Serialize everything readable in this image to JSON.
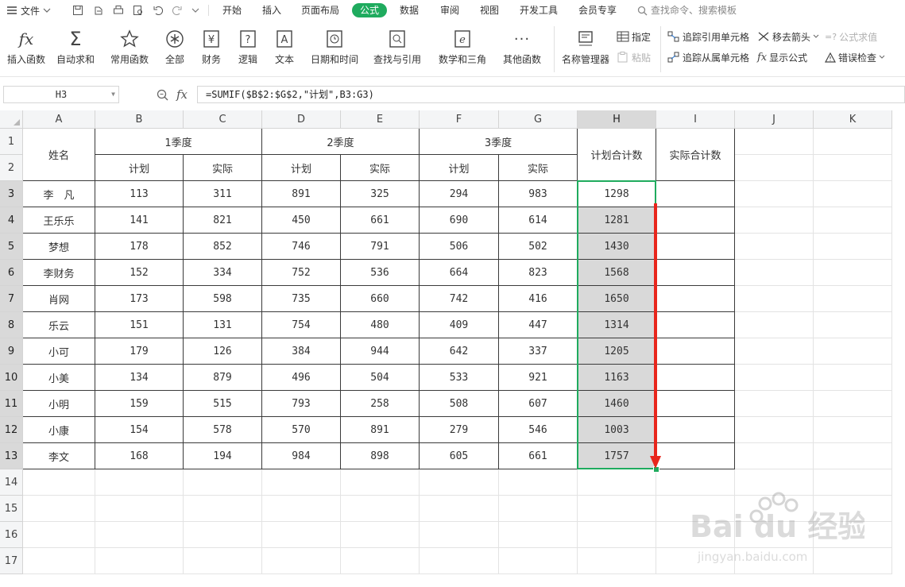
{
  "menubar": {
    "file_label": "文件",
    "tabs": [
      {
        "label": "开始",
        "active": false
      },
      {
        "label": "插入",
        "active": false
      },
      {
        "label": "页面布局",
        "active": false
      },
      {
        "label": "公式",
        "active": true
      },
      {
        "label": "数据",
        "active": false
      },
      {
        "label": "审阅",
        "active": false
      },
      {
        "label": "视图",
        "active": false
      },
      {
        "label": "开发工具",
        "active": false
      },
      {
        "label": "会员专享",
        "active": false
      }
    ],
    "search_placeholder": "查找命令、搜索模板"
  },
  "ribbon": {
    "buttons": [
      {
        "label": "插入函数",
        "icon": "function-icon"
      },
      {
        "label": "自动求和",
        "icon": "sigma-icon"
      },
      {
        "label": "常用函数",
        "icon": "star-icon"
      },
      {
        "label": "全部",
        "icon": "asterisk-icon"
      },
      {
        "label": "财务",
        "icon": "yen-icon"
      },
      {
        "label": "逻辑",
        "icon": "question-icon"
      },
      {
        "label": "文本",
        "icon": "text-a-icon"
      },
      {
        "label": "日期和时间",
        "icon": "clock-icon"
      },
      {
        "label": "查找与引用",
        "icon": "lookup-icon"
      },
      {
        "label": "数学和三角",
        "icon": "theta-icon"
      },
      {
        "label": "其他函数",
        "icon": "more-icon"
      },
      {
        "label": "名称管理器",
        "icon": "name-manager-icon"
      }
    ],
    "small": {
      "assign": "指定",
      "paste": "粘贴",
      "trace_precedents": "追踪引用单元格",
      "trace_dependents": "追踪从属单元格",
      "remove_arrows": "移去箭头",
      "show_formulas": "显示公式",
      "evaluate": "公式求值",
      "error_check": "错误检查"
    }
  },
  "formula_bar": {
    "cell_ref": "H3",
    "fx_label": "fx",
    "formula": "=SUMIF($B$2:$G$2,\"计划\",B3:G3)"
  },
  "columns": [
    "A",
    "B",
    "C",
    "D",
    "E",
    "F",
    "G",
    "H",
    "I",
    "J",
    "K"
  ],
  "rows": [
    "1",
    "2",
    "3",
    "4",
    "5",
    "6",
    "7",
    "8",
    "9",
    "10",
    "11",
    "12",
    "13",
    "14",
    "15",
    "16",
    "17"
  ],
  "table": {
    "name_header": "姓名",
    "quarters": [
      "1季度",
      "2季度",
      "3季度"
    ],
    "sub_plan": "计划",
    "sub_actual": "实际",
    "plan_total_header": "计划合计数",
    "actual_total_header": "实际合计数",
    "records": [
      {
        "name": "李　凡",
        "q1p": 113,
        "q1a": 311,
        "q2p": 891,
        "q2a": 325,
        "q3p": 294,
        "q3a": 983,
        "plan_total": 1298
      },
      {
        "name": "王乐乐",
        "q1p": 141,
        "q1a": 821,
        "q2p": 450,
        "q2a": 661,
        "q3p": 690,
        "q3a": 614,
        "plan_total": 1281
      },
      {
        "name": "梦想",
        "q1p": 178,
        "q1a": 852,
        "q2p": 746,
        "q2a": 791,
        "q3p": 506,
        "q3a": 502,
        "plan_total": 1430
      },
      {
        "name": "李财务",
        "q1p": 152,
        "q1a": 334,
        "q2p": 752,
        "q2a": 536,
        "q3p": 664,
        "q3a": 823,
        "plan_total": 1568
      },
      {
        "name": "肖网",
        "q1p": 173,
        "q1a": 598,
        "q2p": 735,
        "q2a": 660,
        "q3p": 742,
        "q3a": 416,
        "plan_total": 1650
      },
      {
        "name": "乐云",
        "q1p": 151,
        "q1a": 131,
        "q2p": 754,
        "q2a": 480,
        "q3p": 409,
        "q3a": 447,
        "plan_total": 1314
      },
      {
        "name": "小可",
        "q1p": 179,
        "q1a": 126,
        "q2p": 384,
        "q2a": 944,
        "q3p": 642,
        "q3a": 337,
        "plan_total": 1205
      },
      {
        "name": "小美",
        "q1p": 134,
        "q1a": 879,
        "q2p": 496,
        "q2a": 504,
        "q3p": 533,
        "q3a": 921,
        "plan_total": 1163
      },
      {
        "name": "小明",
        "q1p": 159,
        "q1a": 515,
        "q2p": 793,
        "q2a": 258,
        "q3p": 508,
        "q3a": 607,
        "plan_total": 1460
      },
      {
        "name": "小康",
        "q1p": 154,
        "q1a": 578,
        "q2p": 570,
        "q2a": 891,
        "q3p": 279,
        "q3a": 546,
        "plan_total": 1003
      },
      {
        "name": "李文",
        "q1p": 168,
        "q1a": 194,
        "q2p": 984,
        "q2a": 898,
        "q3p": 605,
        "q3a": 661,
        "plan_total": 1757
      }
    ]
  },
  "watermark": {
    "brand": "Bai du 经验",
    "url": "jingyan.baidu.com"
  },
  "colors": {
    "accent": "#1fab5e",
    "arrow": "#e8261c",
    "selection": "#d9d9d9"
  }
}
